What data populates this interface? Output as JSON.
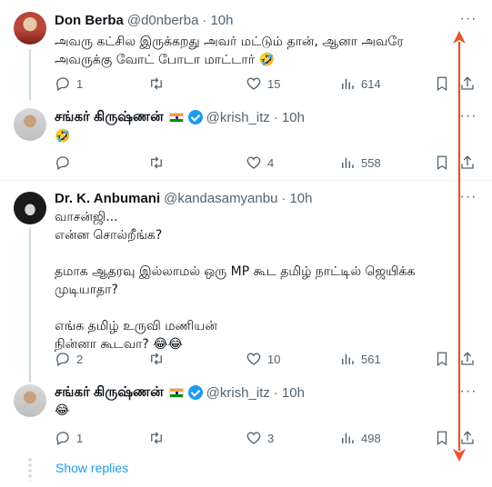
{
  "tweets": [
    {
      "name": "Don Berba",
      "handle": "@d0nberba",
      "time": "10h",
      "text": "அவரு கட்சில இருக்கறது அவர் மட்டும் தான், ஆனா அவரே\nஅவருக்கு வோட் போடா மாட்டார் 🤣",
      "replies": "1",
      "retweets": "",
      "likes": "15",
      "views": "614",
      "flag": false,
      "verified": false
    },
    {
      "name": "சங்கர் கிருஷ்ணன்",
      "handle": "@krish_itz",
      "time": "10h",
      "text": "🤣",
      "replies": "",
      "retweets": "",
      "likes": "4",
      "views": "558",
      "flag": true,
      "verified": true
    },
    {
      "name": "Dr. K. Anbumani",
      "handle": "@kandasamyanbu",
      "time": "10h",
      "text": "வாசன்ஜி...\nஎன்ன சொல்றீங்க?\n\nதமாக ஆதரவு இல்லாமல் ஒரு MP கூட தமிழ் நாட்டில் ஜெயிக்க\nமுடியாதா?\n\nஎங்க தமிழ் உருவி மணியன்\nநின்னா கூடவா? 😂😂",
      "replies": "2",
      "retweets": "",
      "likes": "10",
      "views": "561",
      "flag": false,
      "verified": false
    },
    {
      "name": "சங்கர் கிருஷ்ணன்",
      "handle": "@krish_itz",
      "time": "10h",
      "text": "😂",
      "replies": "1",
      "retweets": "",
      "likes": "3",
      "views": "498",
      "flag": true,
      "verified": true
    }
  ],
  "show_replies": "Show replies",
  "icons": {
    "reply": "reply-icon",
    "retweet": "retweet-icon",
    "like": "heart-icon",
    "views": "views-icon",
    "bookmark": "bookmark-icon",
    "share": "share-icon",
    "more": "more-icon"
  },
  "colors": {
    "text": "#0f1419",
    "muted": "#536471",
    "link": "#1d9bf0",
    "annotation_arrow": "#e8542a"
  }
}
